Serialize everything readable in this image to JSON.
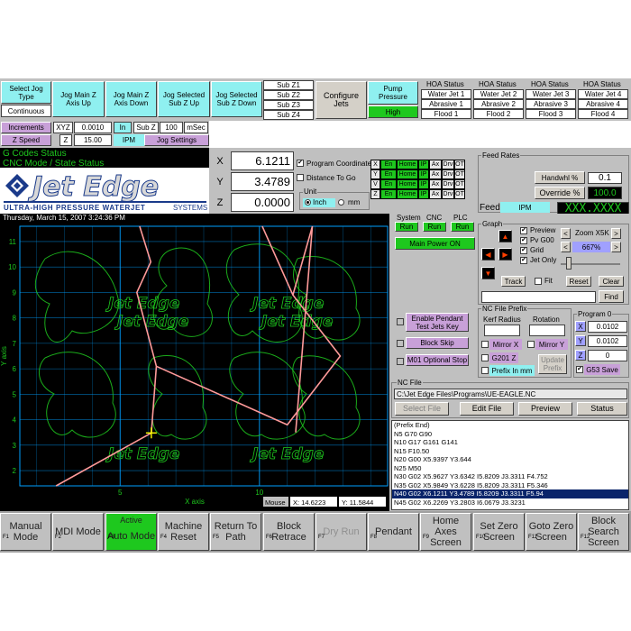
{
  "top": {
    "select_jog_type": "Select Jog Type",
    "continuous": "Continuous",
    "jog_main_z_up": "Jog Main Z Axis Up",
    "jog_main_z_down": "Jog Main Z Axis Down",
    "jog_selected_up": "Jog Selected Sub Z Up",
    "jog_selected_down": "Jog Selected Sub Z Down",
    "subz": [
      "Sub Z1",
      "Sub Z2",
      "Sub Z3",
      "Sub Z4"
    ],
    "configure_jets": "Configure Jets",
    "pump_pressure": "Pump Pressure",
    "pump_level": "High",
    "hoa_status": "HOA Status",
    "jets": [
      {
        "water": "Water Jet 1",
        "abrasive": "Abrasive 1",
        "flood": "Flood 1"
      },
      {
        "water": "Water Jet 2",
        "abrasive": "Abrasive 2",
        "flood": "Flood 2"
      },
      {
        "water": "Water Jet 3",
        "abrasive": "Abrasive 3",
        "flood": "Flood 3"
      },
      {
        "water": "Water Jet 4",
        "abrasive": "Abrasive 4",
        "flood": "Flood 4"
      }
    ]
  },
  "increments": {
    "label": "Increments",
    "xyz": "XYZ",
    "xyz_value": "0.0010",
    "unit": "In",
    "subz": "Sub Z",
    "subz_value": "100",
    "msec": "mSec",
    "zspeed": "Z Speed",
    "z": "Z",
    "z_value": "15.00",
    "ipm": "IPM",
    "jog_settings": "Jog Settings"
  },
  "status": {
    "gcodes": "G Codes Status",
    "cnc_mode": "CNC Mode / State Status"
  },
  "logo": {
    "brand": "Jet Edge",
    "tagline": "Ultra-High Pressure Waterjet",
    "systems": "Systems"
  },
  "axes": [
    {
      "name": "X",
      "value": "6.1211"
    },
    {
      "name": "Y",
      "value": "3.4789"
    },
    {
      "name": "Z",
      "value": "0.0000"
    }
  ],
  "coord": {
    "program_coordinates": "Program Coordinates",
    "distance_to_go": "Distance To Go",
    "unit": "Unit",
    "inch": "Inch",
    "mm": "mm"
  },
  "axis_flags": [
    {
      "axis": "X",
      "cells": [
        "En",
        "Home",
        "IP",
        "Ax",
        "Drv",
        "OT"
      ]
    },
    {
      "axis": "Y",
      "cells": [
        "En",
        "Home",
        "IP",
        "Ax",
        "Drv",
        "OT"
      ]
    },
    {
      "axis": "V",
      "cells": [
        "En",
        "Home",
        "IP",
        "Ax",
        "Drv",
        "OT"
      ]
    },
    {
      "axis": "Z",
      "cells": [
        "En",
        "Home",
        "IP",
        "Ax",
        "Drv",
        "OT"
      ]
    }
  ],
  "feed": {
    "title": "Feed Rates",
    "handwhl": "Handwhl %",
    "handwhl_value": "0.1",
    "override": "Override %",
    "override_value": "100.0",
    "feed": "Feed",
    "ipm": "IPM",
    "feed_value": "XXX.XXXX"
  },
  "datetime": "Thursday, March 15, 2007 3:24:36 PM",
  "system": {
    "system": "System",
    "cnc": "CNC",
    "plc": "PLC",
    "run": "Run",
    "main_power": "Main Power ON"
  },
  "graph": {
    "title": "Graph",
    "preview": "Preview",
    "pv_g00": "Pv G00",
    "grid": "Grid",
    "jet_only": "Jet Only",
    "zoom": "Zoom X5K",
    "zoom_pct": "667%",
    "track": "Track",
    "fit": "Fit",
    "reset": "Reset",
    "clear": "Clear",
    "find": "Find"
  },
  "options": {
    "pendant": "Enable Pendant Test Jets Key",
    "block_skip": "Block Skip",
    "m01": "M01 Optional Stop"
  },
  "prefix": {
    "title": "NC File Prefix",
    "kerf": "Kerf Radius",
    "rotation": "Rotation",
    "mirror_x": "Mirror X",
    "mirror_y": "Mirror Y",
    "g201z": "G201 Z",
    "prefix_mm": "Prefix In mm",
    "update_prefix": "Update Prefix"
  },
  "program0": {
    "title": "Program 0",
    "x": "0.0102",
    "y": "0.0102",
    "z": "0",
    "g53": "G53 Save"
  },
  "ncfile": {
    "title": "NC File",
    "path": "C:\\Jet Edge Files\\Programs\\UE-EAGLE.NC",
    "select_file": "Select File",
    "edit_file": "Edit File",
    "preview": "Preview",
    "status": "Status",
    "lines": [
      "(Prefix End)",
      "N5 G70 G90",
      "N10 G17 G161 G141",
      "N15 F10.50",
      "N20 G00 X5.9397 Y3.644",
      "N25 M50",
      "N30 G02 X5.9627 Y3.6342 I5.8209 J3.3311 F4.752",
      "N35 G02 X5.9849 Y3.6228 I5.8209 J3.3311 F5.346",
      "N40 G02 X6.1211 Y3.4789 I5.8209 J3.3311 F5.94",
      "N45 G02 X6.2269 Y3.2803 I6.0679 J3.3231"
    ]
  },
  "plot": {
    "ylabel": "Y axis",
    "xlabel": "X axis",
    "mouse": "Mouse",
    "mouse_x": "X: 14.6223",
    "mouse_y": "Y: 11.5844",
    "xticks": [
      "5",
      "10"
    ],
    "yticks": [
      "2",
      "3",
      "4",
      "5",
      "6",
      "7",
      "8",
      "9",
      "10",
      "11"
    ],
    "logo_text": [
      "Jet Edge",
      "Jet Edge",
      "Jet Edge",
      "Jet Edge",
      "Jet Edge",
      "Jet Edge"
    ]
  },
  "chart_data": {
    "type": "line",
    "xlabel": "X axis",
    "ylabel": "Y axis",
    "xlim": [
      1.4,
      14.6
    ],
    "ylim": [
      1.4,
      11.6
    ],
    "series": [
      {
        "x": [
          2.7,
          6.12
        ],
        "y": [
          1.4,
          3.48
        ]
      },
      {
        "x": [
          6.12,
          6.3,
          5.6,
          6.1,
          5.7
        ],
        "y": [
          3.48,
          6.1,
          9.0,
          10.2,
          11.6
        ]
      },
      {
        "x": [
          6.3,
          11.0,
          12.9,
          11.2,
          11.9,
          11.3
        ],
        "y": [
          6.1,
          3.8,
          6.5,
          8.9,
          11.6,
          3.5
        ]
      },
      {
        "x": [
          10.1,
          11.2
        ],
        "y": [
          11.6,
          8.9
        ]
      }
    ],
    "cursor": {
      "x": 6.12,
      "y": 3.48
    },
    "colors": {
      "toolpath": "#ff9a9a",
      "outline": "#1ec81e",
      "grid": "#00a0ff",
      "background": "#000000"
    }
  },
  "fkeys": [
    {
      "num": "F1",
      "label": "Manual Mode"
    },
    {
      "num": "F2",
      "label": "MDI Mode"
    },
    {
      "num": "F3",
      "label": "Auto Mode",
      "active": "Active"
    },
    {
      "num": "F4",
      "label": "Machine Reset"
    },
    {
      "num": "F5",
      "label": "Return To Path"
    },
    {
      "num": "F6",
      "label": "Block Retrace"
    },
    {
      "num": "F7",
      "label": "Dry Run"
    },
    {
      "num": "F8",
      "label": "Pendant"
    },
    {
      "num": "F9",
      "label": "Home Axes Screen"
    },
    {
      "num": "F10",
      "label": "Set Zero Screen"
    },
    {
      "num": "F11",
      "label": "Goto Zero Screen"
    },
    {
      "num": "F12",
      "label": "Block Search Screen"
    }
  ]
}
